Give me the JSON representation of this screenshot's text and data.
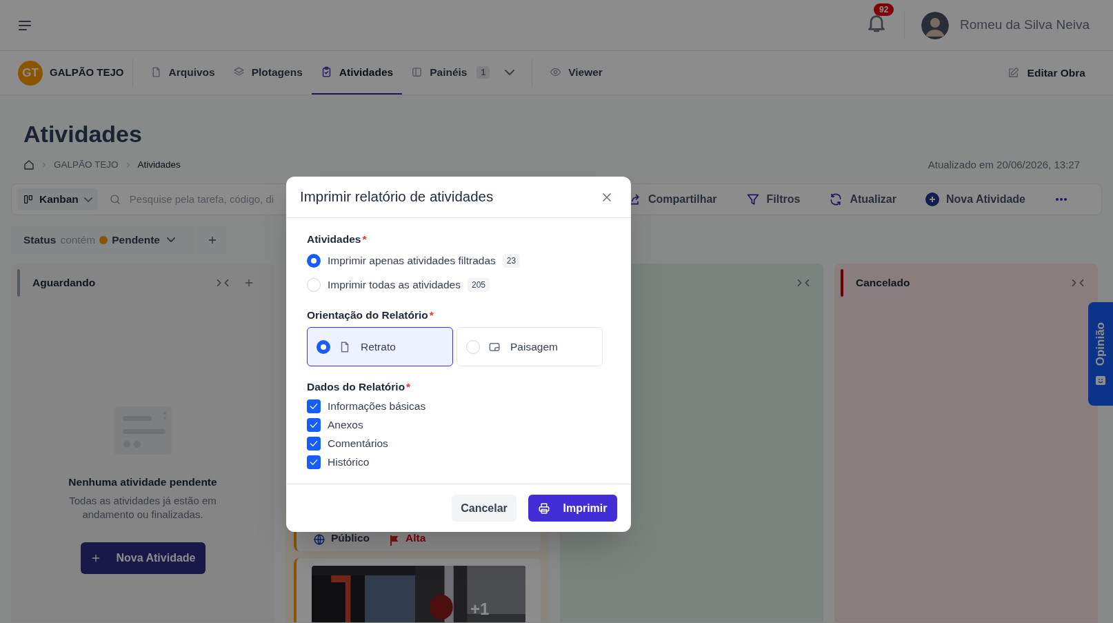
{
  "header": {
    "notifications": "92",
    "user_name": "Romeu da Silva Neiva"
  },
  "project": {
    "initials": "GT",
    "name": "GALPÃO TEJO"
  },
  "nav_tab_groups": [
    [
      {
        "label": "Arquivos",
        "selected": false
      },
      {
        "label": "Plotagens",
        "selected": false
      },
      {
        "label": "Atividades",
        "selected": true
      },
      {
        "label": "Painéis",
        "count": "1",
        "selected": false
      }
    ],
    [
      {
        "label": "Viewer",
        "selected": false
      }
    ]
  ],
  "edit_button": "Editar Obra",
  "page_title": "Atividades",
  "breadcrumb": [
    "GALPÃO TEJO",
    "Atividades"
  ],
  "updated": "Atualizado em 20/06/2026, 13:27",
  "toolbar": {
    "view": "Kanban",
    "search_placeholder": "Pesquise pela tarefa, código, di",
    "actions": [
      "Compartilhar",
      "Filtros",
      "Atualizar",
      "Nova Atividade"
    ]
  },
  "filter_chip": {
    "field": "Status",
    "operator": "contém",
    "value": "Pendente"
  },
  "columns": [
    {
      "kind": "empty",
      "title": "Aguardando",
      "empty_title": "Nenhuma atividade pendente",
      "empty_text": "Todas as atividades já estão em andamento ou finalizadas.",
      "button": "Nova Atividade"
    },
    {
      "kind": "cards",
      "cards": [
        {
          "kind": "meta",
          "visibility": "Público",
          "priority": "Alta"
        },
        {
          "kind": "picture",
          "extra": "+1"
        }
      ]
    },
    {
      "kind": "plain"
    },
    {
      "kind": "plain",
      "title": "Cancelado"
    }
  ],
  "feedback_tab": "Opinião",
  "dialog": {
    "title": "Imprimir relatório de atividades",
    "scope": {
      "label": "Atividades",
      "mark": "*",
      "options": [
        {
          "label": "Imprimir apenas atividades filtradas",
          "count": "23",
          "selected": true
        },
        {
          "label": "Imprimir todas as atividades",
          "count": "205",
          "selected": false
        }
      ]
    },
    "orientation": {
      "label": "Orientação do Relatório",
      "mark": "*",
      "options": [
        {
          "kind": "portrait",
          "label": "Retrato",
          "selected": true
        },
        {
          "kind": "landscape",
          "label": "Paisagem",
          "selected": false
        }
      ]
    },
    "data": {
      "label": "Dados do Relatório",
      "mark": "*",
      "items": [
        {
          "label": "Informações básicas",
          "checked": true
        },
        {
          "label": "Anexos",
          "checked": true
        },
        {
          "label": "Comentários",
          "checked": true
        },
        {
          "label": "Histórico",
          "checked": true
        }
      ]
    },
    "buttons": [
      {
        "kind": "secondary",
        "label": "Cancelar"
      },
      {
        "kind": "primary",
        "label": "Imprimir"
      }
    ]
  }
}
